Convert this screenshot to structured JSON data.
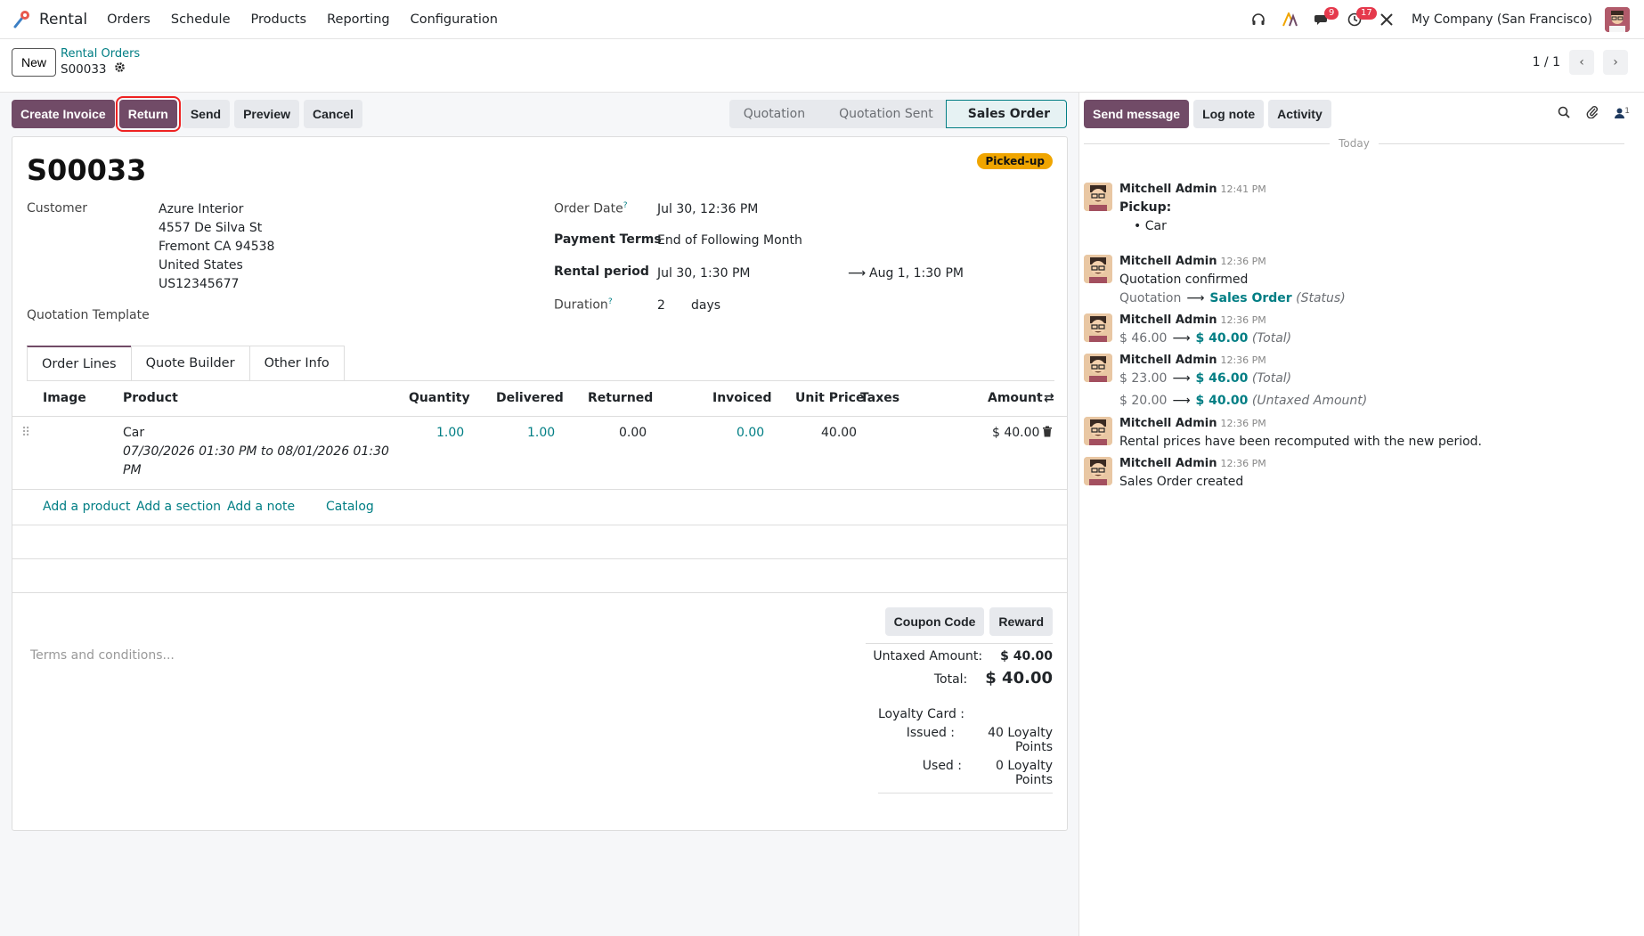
{
  "nav": {
    "app_name": "Rental",
    "menu": [
      "Orders",
      "Schedule",
      "Products",
      "Reporting",
      "Configuration"
    ],
    "messages_count": "9",
    "activities_count": "17",
    "company": "My Company (San Francisco)"
  },
  "control": {
    "new_label": "New",
    "breadcrumb_parent": "Rental Orders",
    "breadcrumb_current": "S00033",
    "pager": "1 / 1"
  },
  "actions": {
    "create_invoice": "Create Invoice",
    "return": "Return",
    "send": "Send",
    "preview": "Preview",
    "cancel": "Cancel"
  },
  "stages": [
    "Quotation",
    "Quotation Sent",
    "Sales Order"
  ],
  "form": {
    "name": "S00033",
    "ribbon": "Picked-up",
    "customer_label": "Customer",
    "customer_name": "Azure Interior",
    "address_1": "4557 De Silva St",
    "address_2": "Fremont CA 94538",
    "address_3": "United States",
    "vat": "US12345677",
    "quotation_template_label": "Quotation Template",
    "order_date_label": "Order Date",
    "order_date": "Jul 30, 12:36 PM",
    "payment_terms_label": "Payment Terms",
    "payment_terms": "End of Following Month",
    "rental_period_label": "Rental period",
    "rental_start": "Jul 30, 1:30 PM",
    "rental_end": "Aug 1, 1:30 PM",
    "duration_label": "Duration",
    "duration_value": "2",
    "duration_unit": "days"
  },
  "tabs": [
    "Order Lines",
    "Quote Builder",
    "Other Info"
  ],
  "table": {
    "headers": {
      "image": "Image",
      "product": "Product",
      "quantity": "Quantity",
      "delivered": "Delivered",
      "returned": "Returned",
      "invoiced": "Invoiced",
      "unit_price": "Unit Price",
      "taxes": "Taxes",
      "amount": "Amount"
    },
    "row": {
      "product": "Car",
      "description_1": "07/30/2026 01:30 PM to 08/01/2026 01:30",
      "description_2": "PM",
      "quantity": "1.00",
      "delivered": "1.00",
      "returned": "0.00",
      "invoiced": "0.00",
      "unit_price": "40.00",
      "amount": "$ 40.00"
    },
    "add_product": "Add a product",
    "add_section": "Add a section",
    "add_note": "Add a note",
    "catalog": "Catalog"
  },
  "footer": {
    "terms_placeholder": "Terms and conditions...",
    "coupon_code": "Coupon Code",
    "reward": "Reward",
    "untaxed_label": "Untaxed Amount:",
    "untaxed_value": "$ 40.00",
    "total_label": "Total:",
    "total_value": "$ 40.00",
    "loyalty_label": "Loyalty Card :",
    "issued_label": "Issued :",
    "issued_value": "40 Loyalty Points",
    "used_label": "Used :",
    "used_value": "0 Loyalty Points"
  },
  "chatter": {
    "send_message": "Send message",
    "log_note": "Log note",
    "activity": "Activity",
    "followers_count": "1",
    "today": "Today",
    "messages": [
      {
        "author": "Mitchell Admin",
        "time": "12:41 PM",
        "title": "Pickup",
        "bullet": "Car"
      },
      {
        "author": "Mitchell Admin",
        "time": "12:36 PM",
        "text": "Quotation confirmed",
        "from": "Quotation",
        "to": "Sales Order",
        "field": "(Status)"
      },
      {
        "author": "Mitchell Admin",
        "time": "12:36 PM",
        "from": "$ 46.00",
        "to": "$ 40.00",
        "field": "(Total)"
      },
      {
        "author": "Mitchell Admin",
        "time": "12:36 PM",
        "from": "$ 23.00",
        "to": "$ 46.00",
        "field": "(Total)",
        "from2": "$ 20.00",
        "to2": "$ 40.00",
        "field2": "(Untaxed Amount)"
      },
      {
        "author": "Mitchell Admin",
        "time": "12:36 PM",
        "text": "Rental prices have been recomputed with the new period."
      },
      {
        "author": "Mitchell Admin",
        "time": "12:36 PM",
        "text": "Sales Order created"
      }
    ]
  }
}
